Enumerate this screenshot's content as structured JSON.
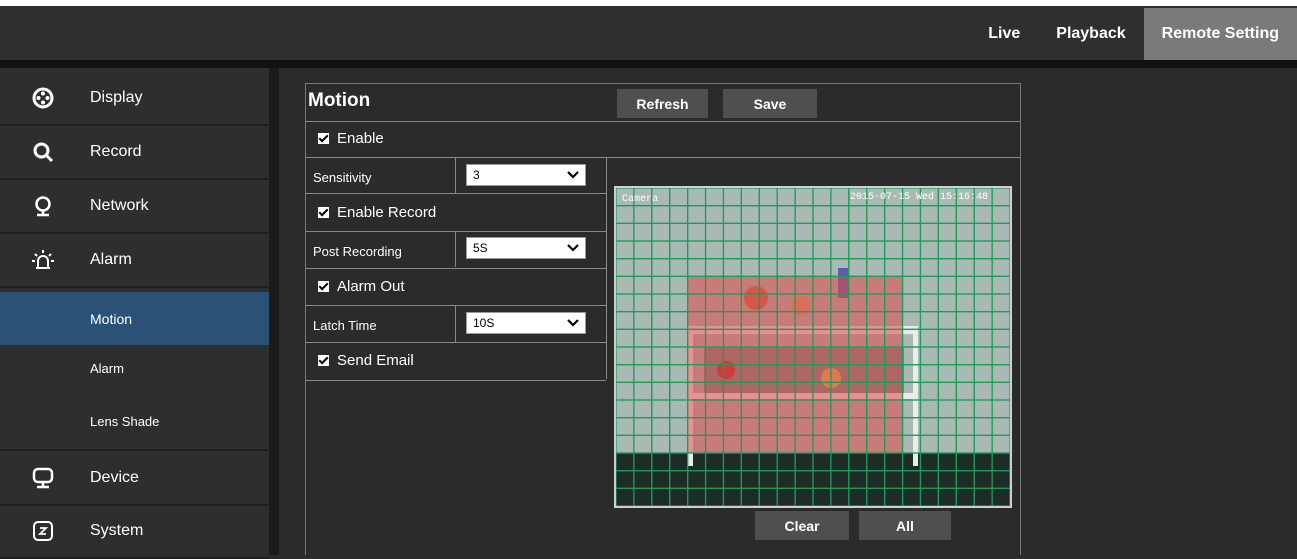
{
  "top_nav": {
    "items": [
      "Live",
      "Playback",
      "Remote Setting"
    ],
    "active": "Remote Setting"
  },
  "sidebar": {
    "items": [
      {
        "label": "Display",
        "icon": "display-icon"
      },
      {
        "label": "Record",
        "icon": "search-icon"
      },
      {
        "label": "Network",
        "icon": "network-icon"
      },
      {
        "label": "Alarm",
        "icon": "alarm-light-icon"
      }
    ],
    "subitems": [
      {
        "label": "Motion",
        "active": true
      },
      {
        "label": "Alarm",
        "active": false
      },
      {
        "label": "Lens Shade",
        "active": false
      }
    ],
    "bottom_items": [
      {
        "label": "Device",
        "icon": "monitor-icon"
      },
      {
        "label": "System",
        "icon": "system-icon"
      }
    ]
  },
  "motion": {
    "title": "Motion",
    "refresh_label": "Refresh",
    "save_label": "Save",
    "enable_label": "Enable",
    "enable_checked": true,
    "sensitivity_label": "Sensitivity",
    "sensitivity_value": "3",
    "enable_record_label": "Enable Record",
    "enable_record_checked": true,
    "post_recording_label": "Post Recording",
    "post_recording_value": "5S",
    "alarm_out_label": "Alarm Out",
    "alarm_out_checked": true,
    "latch_time_label": "Latch Time",
    "latch_time_value": "10S",
    "send_email_label": "Send Email",
    "send_email_checked": true,
    "clear_label": "Clear",
    "all_label": "All"
  },
  "camera": {
    "name": "Camera",
    "timestamp": "2015-07-15 Wed 15:16:48",
    "grid": {
      "columns": 22,
      "rows": 18
    },
    "active_region": {
      "col_start": 4,
      "col_end": 15,
      "row_start": 5,
      "row_end": 14
    },
    "colors": {
      "grid": "#1f9a5a",
      "active": "#e24848"
    }
  },
  "colors": {
    "active_nav": "#7a7a7a",
    "active_subitem": "#2b5177",
    "button": "#4f4f4f"
  }
}
